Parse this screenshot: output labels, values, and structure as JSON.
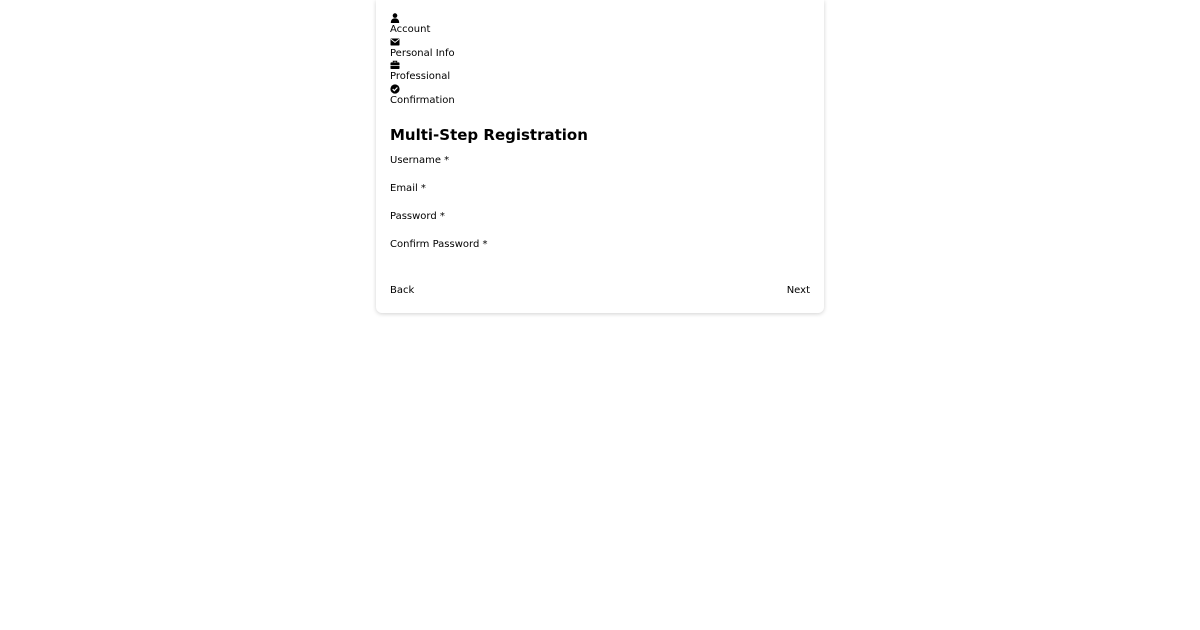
{
  "steps": [
    {
      "label": "Account",
      "icon": "user-icon"
    },
    {
      "label": "Personal Info",
      "icon": "envelope-icon"
    },
    {
      "label": "Professional",
      "icon": "briefcase-icon"
    },
    {
      "label": "Confirmation",
      "icon": "check-circle-icon"
    }
  ],
  "form": {
    "title": "Multi-Step Registration",
    "fields": [
      {
        "label": "Username *",
        "value": ""
      },
      {
        "label": "Email *",
        "value": ""
      },
      {
        "label": "Password *",
        "value": ""
      },
      {
        "label": "Confirm Password *",
        "value": ""
      }
    ]
  },
  "nav": {
    "back_label": "Back",
    "next_label": "Next"
  },
  "colors": {
    "background": "#ffffff",
    "text": "#000000"
  }
}
